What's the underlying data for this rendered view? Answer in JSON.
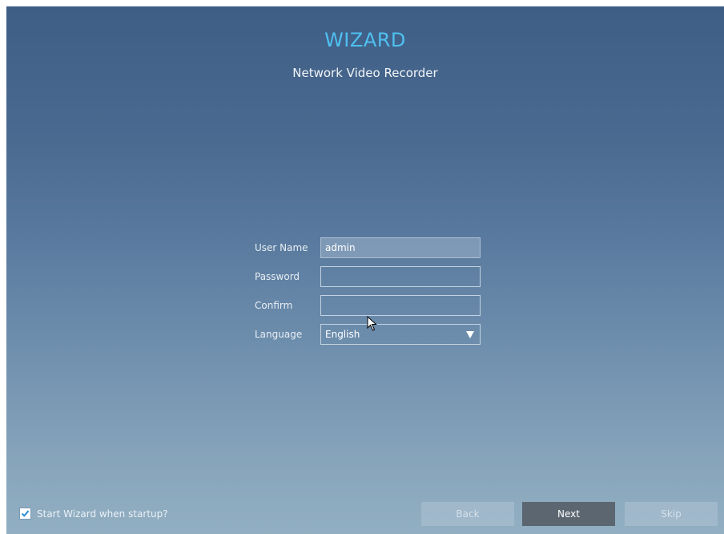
{
  "header": {
    "title": "WIZARD",
    "subtitle": "Network Video Recorder"
  },
  "form": {
    "username_label": "User Name",
    "username_value": "admin",
    "password_label": "Password",
    "password_value": "",
    "confirm_label": "Confirm",
    "confirm_value": "",
    "language_label": "Language",
    "language_value": "English"
  },
  "footer": {
    "startup_label": "Start Wizard when startup?",
    "startup_checked": true,
    "back_label": "Back",
    "next_label": "Next",
    "skip_label": "Skip"
  },
  "icons": {
    "dropdown": "chevron-down-icon",
    "checkbox": "checkmark-icon",
    "cursor": "mouse-pointer-icon"
  },
  "colors": {
    "title": "#4fc0f0",
    "next_button": "#5b6670",
    "checkbox_check": "#2a8fd6"
  }
}
